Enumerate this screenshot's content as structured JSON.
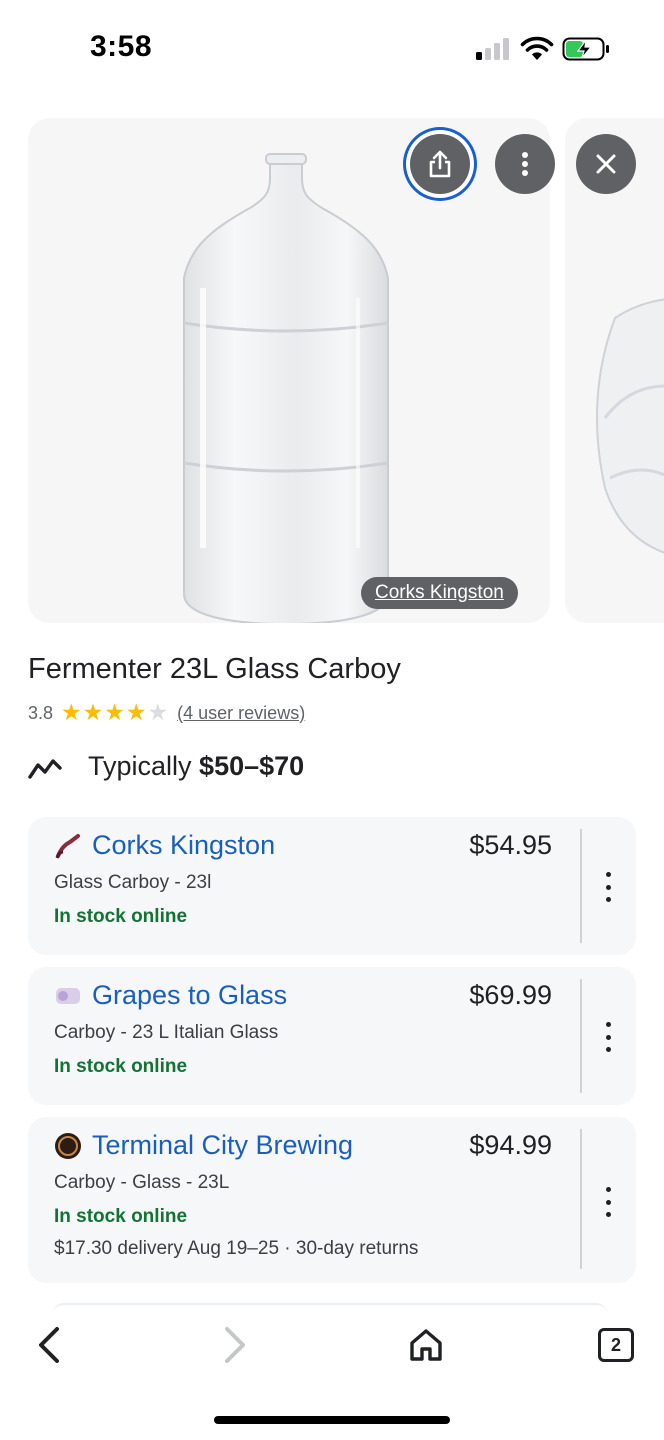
{
  "status_bar": {
    "time": "3:58"
  },
  "product": {
    "image_source_label": "Corks Kingston",
    "title": "Fermenter 23L Glass Carboy",
    "rating": "3.8",
    "rating_stars": 4,
    "reviews_link": "(4 user reviews)",
    "typical_prefix": "Typically ",
    "typical_range": "$50–$70"
  },
  "offers": [
    {
      "seller": "Corks Kingston",
      "price": "$54.95",
      "description": "Glass Carboy - 23l",
      "stock": "In stock online",
      "extra": ""
    },
    {
      "seller": "Grapes to Glass",
      "price": "$69.99",
      "description": "Carboy - 23 L Italian Glass",
      "stock": "In stock online",
      "extra": ""
    },
    {
      "seller": "Terminal City Brewing",
      "price": "$94.99",
      "description": "Carboy - Glass - 23L",
      "stock": "In stock online",
      "extra": "$17.30 delivery Aug 19–25 · 30-day returns"
    }
  ],
  "nav": {
    "tab_count": "2"
  },
  "colors": {
    "link_blue": "#1a5fbd",
    "stock_green": "#137333",
    "star_yellow": "#fbbc04",
    "focus_ring": "#1a5fd0"
  },
  "icons": [
    "signal-icon",
    "wifi-icon",
    "battery-charging-icon",
    "share-icon",
    "more-vert-icon",
    "close-icon",
    "trend-icon",
    "back-icon",
    "forward-icon",
    "home-icon",
    "tabs-icon"
  ]
}
